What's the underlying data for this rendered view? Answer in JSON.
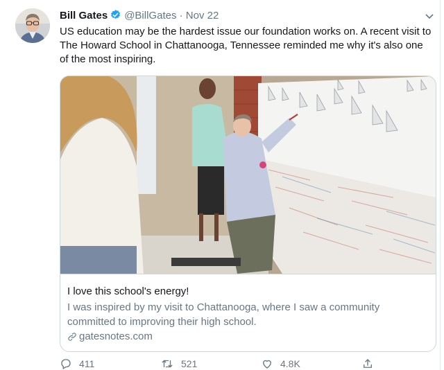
{
  "tweet": {
    "author_name": "Bill Gates",
    "handle": "@BillGates",
    "separator": "·",
    "date": "Nov 22",
    "text": "US education may be the hardest issue our foundation works on. A recent visit to The Howard School in Chattanooga, Tennessee reminded me why it's also one of the most inspiring."
  },
  "card": {
    "title": "I love this school's energy!",
    "description": "I was inspired by my visit to Chattanooga, where I saw a community committed to improving their high school.",
    "domain": "gatesnotes.com"
  },
  "actions": {
    "replies": "411",
    "retweets": "521",
    "likes": "4.8K"
  },
  "icons": {
    "verified": "verified-badge-icon",
    "caret": "chevron-down-icon",
    "link": "link-icon",
    "reply": "reply-icon",
    "retweet": "retweet-icon",
    "like": "heart-icon",
    "share": "share-icon"
  },
  "colors": {
    "verified_blue": "#1da1f2",
    "secondary_text": "#657786",
    "border": "#ccd6dd"
  }
}
